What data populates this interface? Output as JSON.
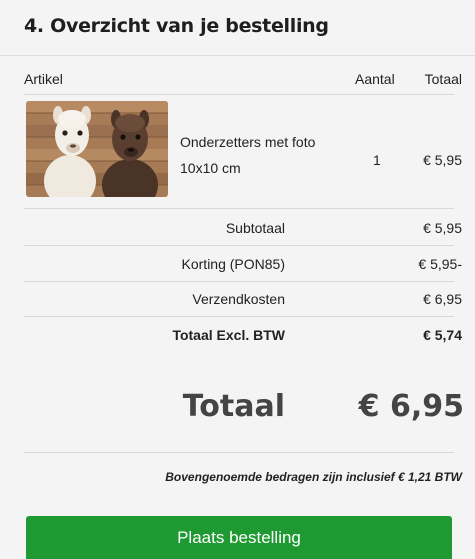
{
  "section": {
    "title": "4. Overzicht van je bestelling"
  },
  "table": {
    "headers": {
      "article": "Artikel",
      "quantity": "Aantal",
      "total": "Totaal"
    },
    "items": [
      {
        "name": "Onderzetters met foto 10x10 cm",
        "quantity": "1",
        "price": "€ 5,95"
      }
    ]
  },
  "summary": {
    "subtotal_label": "Subtotaal",
    "subtotal_value": "€ 5,95",
    "discount_label": "Korting (PON85)",
    "discount_value": "€ 5,95-",
    "shipping_label": "Verzendkosten",
    "shipping_value": "€ 6,95",
    "total_excl_label": "Totaal Excl. BTW",
    "total_excl_value": "€ 5,74"
  },
  "grand_total": {
    "label": "Totaal",
    "value": "€ 6,95"
  },
  "vat_note": "Bovengenoemde bedragen zijn inclusief € 1,21 BTW",
  "actions": {
    "place_order": "Plaats bestelling"
  },
  "colors": {
    "button": "#1f9a32",
    "panel": "#f4f4f4"
  }
}
